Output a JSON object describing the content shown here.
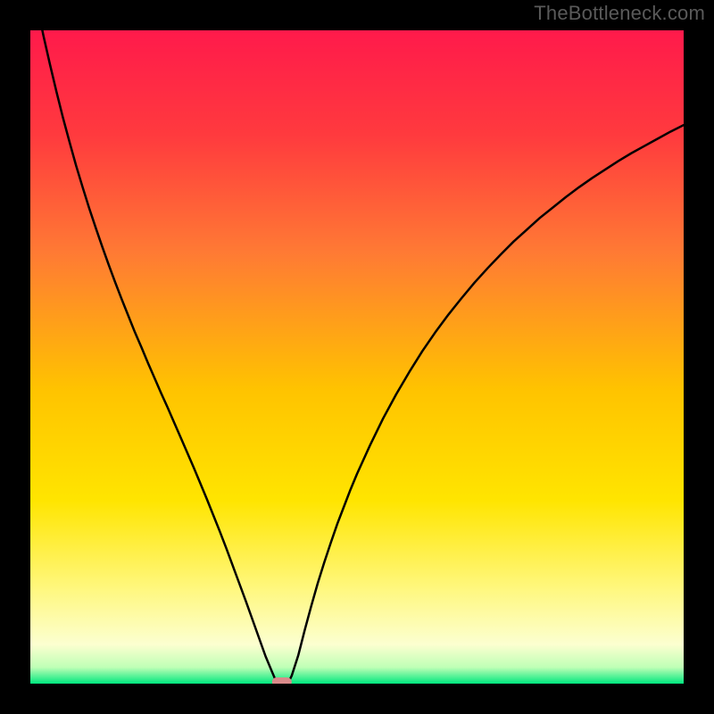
{
  "watermark": "TheBottleneck.com",
  "chart_data": {
    "type": "line",
    "title": "",
    "xlabel": "",
    "ylabel": "",
    "xlim": [
      0,
      1
    ],
    "ylim": [
      0,
      1
    ],
    "axes_visible": false,
    "background_gradient_stops": [
      {
        "offset": 0.0,
        "color": "#ff1a4b"
      },
      {
        "offset": 0.16,
        "color": "#ff3a3e"
      },
      {
        "offset": 0.34,
        "color": "#ff7a34"
      },
      {
        "offset": 0.55,
        "color": "#ffc300"
      },
      {
        "offset": 0.72,
        "color": "#ffe500"
      },
      {
        "offset": 0.85,
        "color": "#fff77a"
      },
      {
        "offset": 0.94,
        "color": "#fcffd0"
      },
      {
        "offset": 0.975,
        "color": "#bfffb6"
      },
      {
        "offset": 1.0,
        "color": "#00e77e"
      }
    ],
    "marker": {
      "x": 0.385,
      "y": 0.0,
      "color": "#d98a8a"
    },
    "series": [
      {
        "name": "curve",
        "color": "#000000",
        "stroke_width": 2.5,
        "x": [
          0.0,
          0.01,
          0.02,
          0.03,
          0.04,
          0.05,
          0.06,
          0.07,
          0.08,
          0.09,
          0.1,
          0.11,
          0.12,
          0.13,
          0.14,
          0.15,
          0.16,
          0.17,
          0.18,
          0.19,
          0.2,
          0.21,
          0.22,
          0.23,
          0.24,
          0.25,
          0.26,
          0.27,
          0.28,
          0.29,
          0.3,
          0.31,
          0.32,
          0.33,
          0.34,
          0.35,
          0.36,
          0.37,
          0.376,
          0.38,
          0.395,
          0.4,
          0.41,
          0.42,
          0.43,
          0.44,
          0.45,
          0.46,
          0.47,
          0.48,
          0.49,
          0.5,
          0.52,
          0.54,
          0.56,
          0.58,
          0.6,
          0.62,
          0.64,
          0.66,
          0.68,
          0.7,
          0.72,
          0.74,
          0.76,
          0.78,
          0.8,
          0.82,
          0.84,
          0.86,
          0.88,
          0.9,
          0.92,
          0.94,
          0.96,
          0.98,
          1.0
        ],
        "values": [
          1.09,
          1.04,
          0.992,
          0.948,
          0.906,
          0.866,
          0.829,
          0.793,
          0.76,
          0.728,
          0.698,
          0.669,
          0.641,
          0.614,
          0.588,
          0.563,
          0.538,
          0.515,
          0.491,
          0.468,
          0.445,
          0.423,
          0.4,
          0.377,
          0.354,
          0.331,
          0.307,
          0.283,
          0.258,
          0.233,
          0.207,
          0.18,
          0.153,
          0.126,
          0.098,
          0.07,
          0.042,
          0.018,
          0.004,
          0.001,
          0.002,
          0.012,
          0.043,
          0.082,
          0.119,
          0.154,
          0.186,
          0.216,
          0.245,
          0.271,
          0.297,
          0.321,
          0.365,
          0.406,
          0.443,
          0.477,
          0.509,
          0.538,
          0.565,
          0.59,
          0.614,
          0.636,
          0.657,
          0.677,
          0.695,
          0.713,
          0.729,
          0.745,
          0.76,
          0.774,
          0.787,
          0.8,
          0.812,
          0.823,
          0.834,
          0.845,
          0.855
        ]
      }
    ]
  }
}
